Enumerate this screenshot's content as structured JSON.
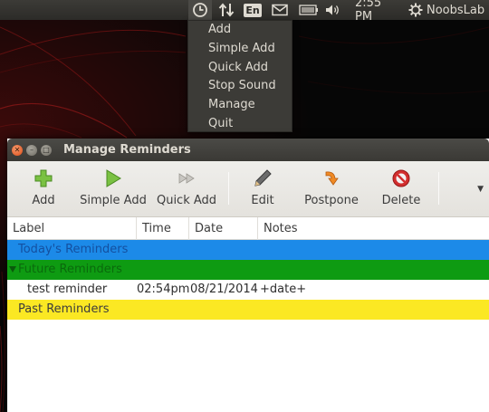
{
  "panel": {
    "time": "2:55 PM",
    "keyboard_layout": "En",
    "user": "NoobsLab",
    "icons": [
      "clock-icon",
      "network-arrows-icon",
      "mail-icon",
      "battery-icon",
      "volume-icon",
      "gear-icon"
    ]
  },
  "menu": {
    "items": [
      {
        "label": "Add"
      },
      {
        "label": "Simple Add"
      },
      {
        "label": "Quick Add"
      },
      {
        "label": "Stop Sound"
      },
      {
        "label": "Manage"
      },
      {
        "label": "Quit"
      }
    ]
  },
  "window": {
    "title": "Manage Reminders",
    "toolbar": {
      "add": "Add",
      "simple_add": "Simple Add",
      "quick_add": "Quick Add",
      "edit": "Edit",
      "postpone": "Postpone",
      "delete": "Delete"
    },
    "table": {
      "columns": {
        "label": "Label",
        "time": "Time",
        "date": "Date",
        "notes": "Notes"
      },
      "groups": {
        "today": "Today's Reminders",
        "future": "Future Reminders",
        "past": "Past Reminders"
      },
      "reminder": {
        "label": "test reminder",
        "time": "02:54pm",
        "date": "08/21/2014",
        "notes": "+date+"
      }
    }
  },
  "colors": {
    "today_row": "#1c8ae8",
    "future_row": "#0e9b12",
    "past_row": "#fbe823",
    "panel": "#3c3b37"
  }
}
